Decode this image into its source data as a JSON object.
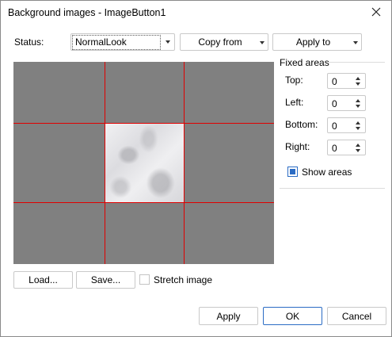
{
  "window": {
    "title": "Background images - ImageButton1"
  },
  "status": {
    "label": "Status:",
    "value": "NormalLook"
  },
  "toolbar": {
    "copy_from": "Copy from",
    "apply_to": "Apply to"
  },
  "fixed_areas": {
    "heading": "Fixed areas",
    "fields": [
      {
        "label": "Top:",
        "value": "0"
      },
      {
        "label": "Left:",
        "value": "0"
      },
      {
        "label": "Bottom:",
        "value": "0"
      },
      {
        "label": "Right:",
        "value": "0"
      }
    ],
    "show_areas": {
      "label": "Show areas",
      "checked": true
    }
  },
  "image_actions": {
    "load": "Load...",
    "save": "Save...",
    "stretch": "Stretch image",
    "stretch_checked": false
  },
  "footer": {
    "apply": "Apply",
    "ok": "OK",
    "cancel": "Cancel"
  },
  "colors": {
    "accent": "#2b6cc4",
    "grid_line": "#e00000",
    "preview_bg": "#808080"
  }
}
